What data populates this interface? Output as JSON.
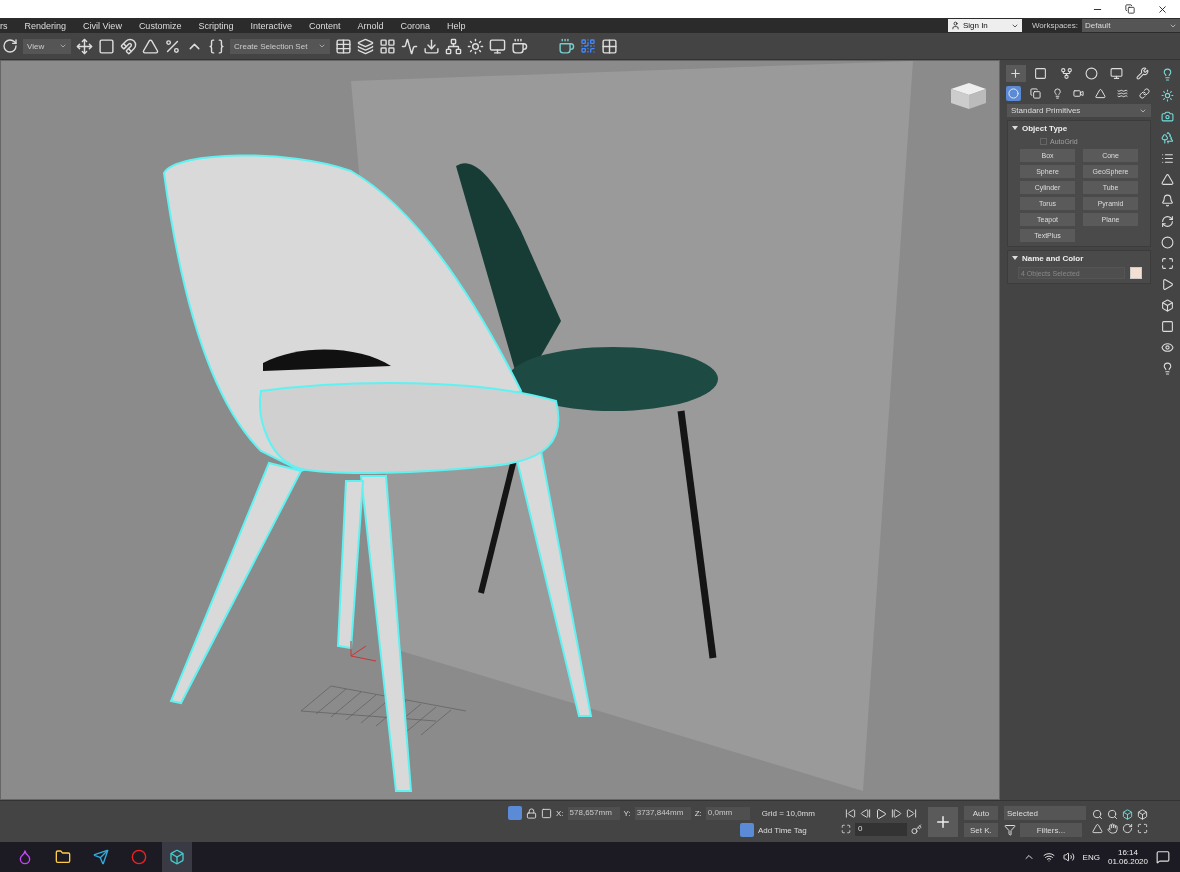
{
  "menu_bar": {
    "items": [
      "rs",
      "Rendering",
      "Civil View",
      "Customize",
      "Scripting",
      "Interactive",
      "Content",
      "Arnold",
      "Corona",
      "Help"
    ],
    "sign_in": "Sign In",
    "workspaces_label": "Workspaces:",
    "workspace": "Default"
  },
  "toolbar": {
    "view_dropdown": "View",
    "selection_set": "Create Selection Set"
  },
  "command_panel": {
    "tabs": [
      {
        "selected": true
      },
      {
        "selected": false
      },
      {
        "selected": false
      },
      {
        "selected": false
      },
      {
        "selected": false
      },
      {
        "selected": false
      }
    ],
    "categories": [
      {
        "selected": true
      },
      {
        "selected": false
      },
      {
        "selected": false
      },
      {
        "selected": false
      },
      {
        "selected": false
      },
      {
        "selected": false
      },
      {
        "selected": false
      }
    ],
    "category_dropdown": "Standard Primitives",
    "object_type": {
      "title": "Object Type",
      "expanded": true,
      "autogrid": {
        "label": "AutoGrid",
        "checked": false,
        "disabled": true
      },
      "buttons": [
        "Box",
        "Cone",
        "Sphere",
        "GeoSphere",
        "Cylinder",
        "Tube",
        "Torus",
        "Pyramid",
        "Teapot",
        "Plane",
        "TextPlus"
      ]
    },
    "name_and_color": {
      "title": "Name and Color",
      "expanded": true,
      "name_field": "4 Objects Selected"
    }
  },
  "status_bar": {
    "x_label": "X:",
    "x": "578,657mm",
    "y_label": "Y:",
    "y": "3737,844mm",
    "z_label": "Z:",
    "z": "0,0mm",
    "grid": "Grid = 10,0mm",
    "time_tag": "Add Time Tag",
    "frame": "0",
    "auto_key": "Auto",
    "set_key": "Set K.",
    "key_filter": "Selected",
    "filters": "Filters..."
  },
  "taskbar": {
    "language": "ENG",
    "time": "16:14",
    "date": "01.06.2020"
  }
}
